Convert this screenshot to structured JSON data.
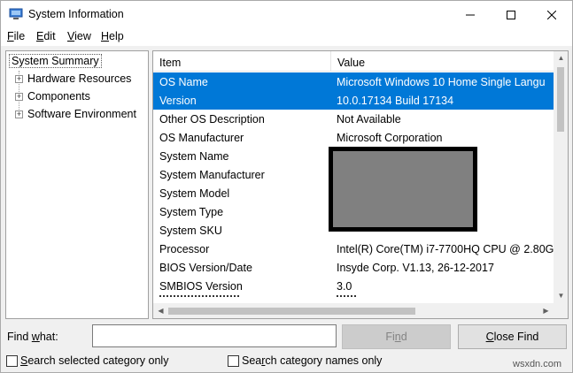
{
  "window": {
    "title": "System Information"
  },
  "menu": [
    {
      "pre": "",
      "u": "F",
      "post": "ile"
    },
    {
      "pre": "",
      "u": "E",
      "post": "dit"
    },
    {
      "pre": "",
      "u": "V",
      "post": "iew"
    },
    {
      "pre": "",
      "u": "H",
      "post": "elp"
    }
  ],
  "tree": {
    "root": "System Summary",
    "children": [
      "Hardware Resources",
      "Components",
      "Software Environment"
    ]
  },
  "details": {
    "columns": {
      "item": "Item",
      "value": "Value"
    },
    "rows": [
      {
        "item": "OS Name",
        "value": "Microsoft Windows 10 Home Single Langu",
        "selected": true
      },
      {
        "item": "Version",
        "value": "10.0.17134 Build 17134",
        "selected": true
      },
      {
        "item": "Other OS Description",
        "value": "Not Available"
      },
      {
        "item": "OS Manufacturer",
        "value": "Microsoft Corporation"
      },
      {
        "item": "System Name",
        "value": ""
      },
      {
        "item": "System Manufacturer",
        "value": ""
      },
      {
        "item": "System Model",
        "value": ""
      },
      {
        "item": "System Type",
        "value": ""
      },
      {
        "item": "System SKU",
        "value": ""
      },
      {
        "item": "Processor",
        "value": "Intel(R) Core(TM) i7-7700HQ CPU @ 2.80G"
      },
      {
        "item": "BIOS Version/Date",
        "value": "Insyde Corp. V1.13, 26-12-2017"
      },
      {
        "item": "SMBIOS Version",
        "value": "3.0"
      }
    ]
  },
  "find": {
    "label_pre": "Find ",
    "label_u": "w",
    "label_post": "hat:",
    "value": "",
    "find_pre": "Fi",
    "find_u": "n",
    "find_post": "d",
    "close_pre": "",
    "close_u": "C",
    "close_post": "lose Find",
    "opt1_pre": "",
    "opt1_u": "S",
    "opt1_post": "earch selected category only",
    "opt2_pre": "Sea",
    "opt2_u": "r",
    "opt2_post": "ch category names only"
  },
  "watermark": "wsxdn.com",
  "colors": {
    "selection": "#0078d7"
  }
}
